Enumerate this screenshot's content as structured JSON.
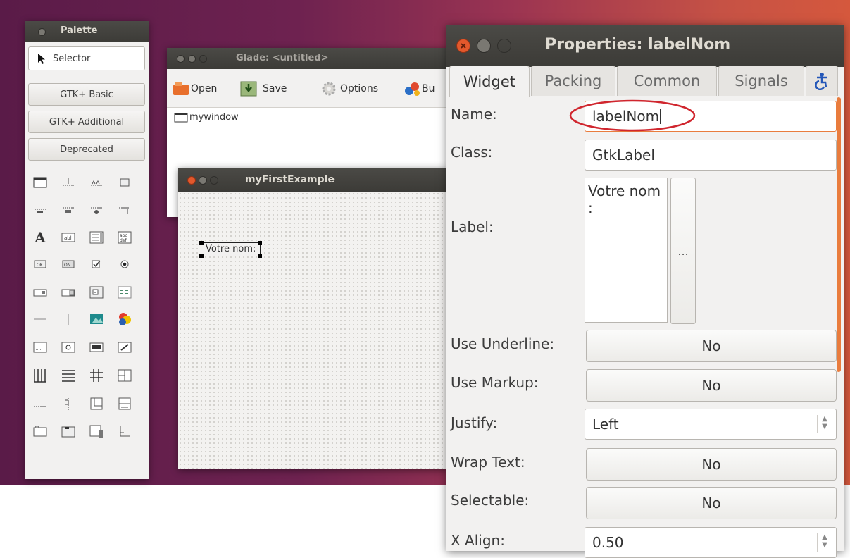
{
  "palette": {
    "title": "Palette",
    "selector_label": "Selector",
    "groups": [
      "GTK+ Basic",
      "GTK+ Additional",
      "Deprecated"
    ]
  },
  "glade": {
    "title": "Glade: <untitled>",
    "toolbar": {
      "open": "Open",
      "save": "Save",
      "options": "Options",
      "build": "Bu"
    },
    "tree_item": "mywindow"
  },
  "example": {
    "title": "myFirstExample",
    "label_text": "Votre nom:"
  },
  "properties": {
    "title": "Properties: labelNom",
    "tabs": [
      "Widget",
      "Packing",
      "Common",
      "Signals"
    ],
    "fields": {
      "name_label": "Name:",
      "name_value": "labelNom",
      "class_label": "Class:",
      "class_value": "GtkLabel",
      "label_label": "Label:",
      "label_value": "Votre nom :",
      "ellipsis": "...",
      "use_underline_label": "Use Underline:",
      "use_underline_value": "No",
      "use_markup_label": "Use Markup:",
      "use_markup_value": "No",
      "justify_label": "Justify:",
      "justify_value": "Left",
      "wrap_text_label": "Wrap Text:",
      "wrap_text_value": "No",
      "selectable_label": "Selectable:",
      "selectable_value": "No",
      "xalign_label": "X Align:",
      "xalign_value": "0.50"
    }
  },
  "colors": {
    "highlight_circle": "#d0262e",
    "close_button": "#e2582c"
  }
}
